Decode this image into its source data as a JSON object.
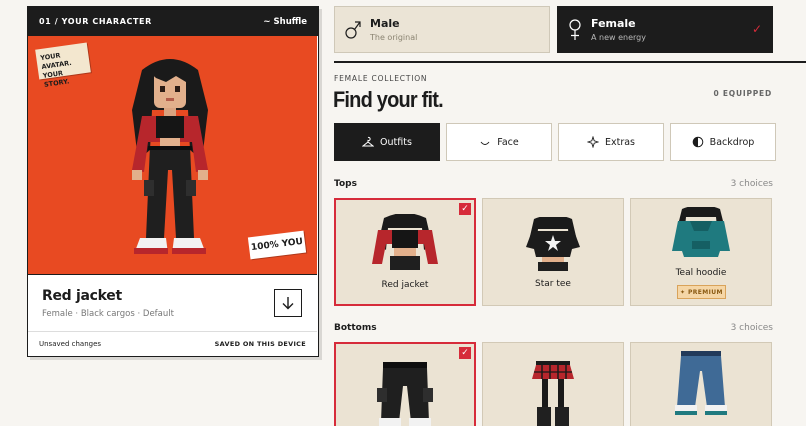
{
  "character_card": {
    "header": "01 / YOUR CHARACTER",
    "shuffle_label": "Shuffle",
    "sticker_top": [
      "YOUR AVATAR.",
      "YOUR STORY."
    ],
    "sticker_bottom": "100% YOU",
    "item_name": "Red jacket",
    "item_sub": "Female · Black cargos · Default",
    "footer_left": "Unsaved changes",
    "footer_right": "SAVED ON THIS DEVICE"
  },
  "gender": [
    {
      "label": "Male",
      "sub": "The original",
      "icon": "male-icon",
      "selected": false
    },
    {
      "label": "Female",
      "sub": "A new energy",
      "icon": "female-icon",
      "selected": true
    }
  ],
  "collection": {
    "eyebrow": "FEMALE COLLECTION",
    "title": "Find your fit.",
    "equipped": "0 EQUIPPED"
  },
  "tabs": [
    {
      "label": "Outfits",
      "icon": "hanger-icon",
      "active": true
    },
    {
      "label": "Face",
      "icon": "smile-icon",
      "active": false
    },
    {
      "label": "Extras",
      "icon": "sparkle-icon",
      "active": false
    },
    {
      "label": "Backdrop",
      "icon": "contrast-icon",
      "active": false
    }
  ],
  "sections": {
    "tops": {
      "label": "Tops",
      "count": "3 choices",
      "items": [
        {
          "name": "Red jacket",
          "selected": true
        },
        {
          "name": "Star tee",
          "selected": false
        },
        {
          "name": "Teal hoodie",
          "selected": false,
          "badge": "✦ PREMIUM"
        }
      ]
    },
    "bottoms": {
      "label": "Bottoms",
      "count": "3 choices",
      "items": [
        {
          "name": "Black cargos",
          "selected": true
        },
        {
          "name": "Plaid skirt",
          "selected": false
        },
        {
          "name": "Blue jeans",
          "selected": false
        }
      ]
    }
  },
  "colors": {
    "accent": "#e84a22",
    "select": "#d62b3a",
    "dark": "#1c1c1c",
    "tile": "#ebe3d3",
    "premium": "#f5d6a6"
  }
}
